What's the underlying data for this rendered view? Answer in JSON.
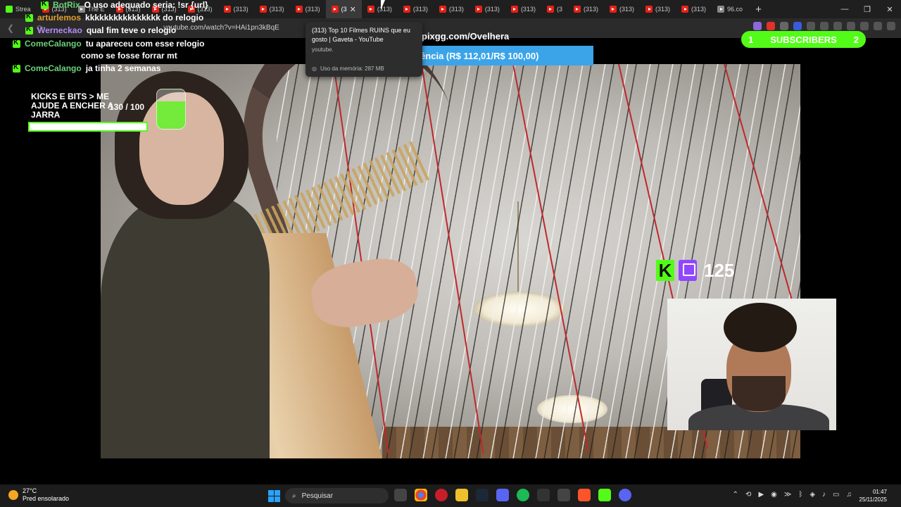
{
  "browser": {
    "tabs": [
      {
        "label": "Strea",
        "kind": "kick"
      },
      {
        "label": "(313)",
        "kind": "yt"
      },
      {
        "label": "The E",
        "kind": "other"
      },
      {
        "label": "(313)",
        "kind": "yt"
      },
      {
        "label": "(313)",
        "kind": "yt"
      },
      {
        "label": "(313)",
        "kind": "yt"
      },
      {
        "label": "(313)",
        "kind": "yt"
      },
      {
        "label": "(313)",
        "kind": "yt"
      },
      {
        "label": "(313)",
        "kind": "yt"
      },
      {
        "label": "(3",
        "kind": "yt",
        "active": true
      },
      {
        "label": "(313)",
        "kind": "yt"
      },
      {
        "label": "(313)",
        "kind": "yt"
      },
      {
        "label": "(313)",
        "kind": "yt"
      },
      {
        "label": "(313)",
        "kind": "yt"
      },
      {
        "label": "(313)",
        "kind": "yt"
      },
      {
        "label": "(3",
        "kind": "yt"
      },
      {
        "label": "(313)",
        "kind": "yt"
      },
      {
        "label": "(313)",
        "kind": "yt"
      },
      {
        "label": "(313)",
        "kind": "yt"
      },
      {
        "label": "(313)",
        "kind": "yt"
      },
      {
        "label": "96.co",
        "kind": "other"
      }
    ],
    "new_tab": "+",
    "url": "youtube.com/watch?v=HAi1pn3kBqE",
    "tooltip": {
      "title": "(313) Top 10 Filmes RUINS que eu gosto | Gaveta - YouTube",
      "domain": "youtube.",
      "memory": "Uso da memória: 287 MB"
    }
  },
  "chat": {
    "messages": [
      {
        "user": "BotRix",
        "text": "O uso adequado seria: !sr {url}",
        "color": "#6cd17a"
      },
      {
        "user": "arturlemos",
        "text": "kkkkkkkkkkkkkkkk do relogio",
        "color": "#e0a030"
      },
      {
        "user": "Werneckao",
        "text": "qual fim teve o relogio",
        "color": "#b48cf2"
      },
      {
        "user": "ComeCalango",
        "text": "tu apareceu com esse relogio",
        "text2": "como se fosse forrar mt",
        "color": "#6cd17a"
      },
      {
        "user": "ComeCalango",
        "text": "ja tinha 2 semanas",
        "color": "#6cd17a"
      }
    ]
  },
  "jar_goal": {
    "title": "KICKS E BITS > ME AJUDE A ENCHER A JARRA",
    "current": "130",
    "target": "/ 100",
    "progress": 1.0
  },
  "sub_goal": {
    "text": "subsistência (R$ 112,01/R$ 100,00)"
  },
  "channel": {
    "url": "pixgg.com/Ovelhera"
  },
  "subscribers": {
    "left": "1",
    "label": "SUBSCRIBERS",
    "right": "2"
  },
  "followers": {
    "count": "125"
  },
  "taskbar": {
    "weather_temp": "27°C",
    "weather_desc": "Pred ensolarado",
    "search_placeholder": "Pesquisar",
    "time": "01:47",
    "date": "25/11/2025"
  }
}
